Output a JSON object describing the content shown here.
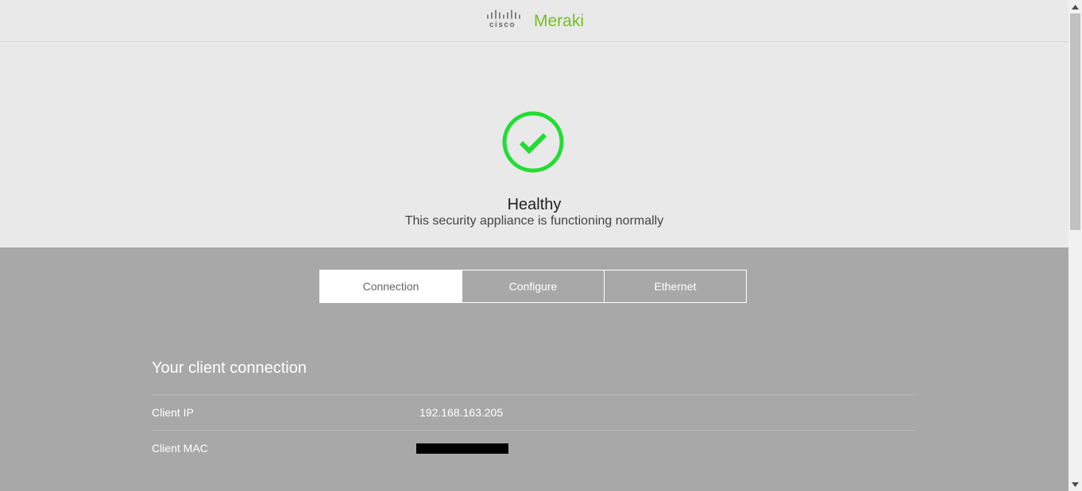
{
  "header": {
    "cisco_text": "cisco",
    "brand": "Meraki",
    "brand_color": "#78be20"
  },
  "status": {
    "icon": "checkmark-circle-icon",
    "color": "#22dd33",
    "title": "Healthy",
    "subtitle": "This security appliance is functioning normally"
  },
  "tabs": [
    {
      "label": "Connection",
      "active": true
    },
    {
      "label": "Configure",
      "active": false
    },
    {
      "label": "Ethernet",
      "active": false
    }
  ],
  "connection": {
    "title": "Your client connection",
    "rows": [
      {
        "label": "Client IP",
        "value": "192.168.163.205"
      },
      {
        "label": "Client MAC",
        "value": "",
        "redacted": true
      }
    ]
  }
}
